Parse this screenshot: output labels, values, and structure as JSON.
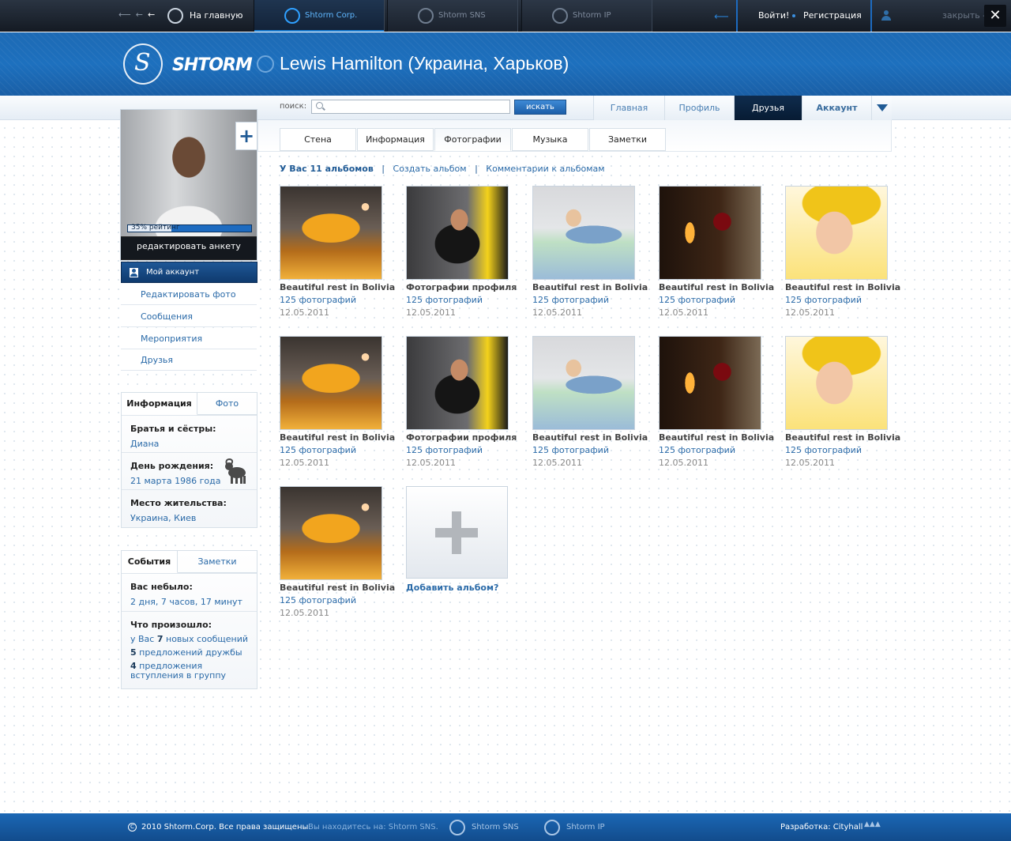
{
  "topbar": {
    "home_label": "На главную",
    "tabs": [
      "Shtorm Corp.",
      "Shtorm SNS",
      "Shtorm IP"
    ],
    "login_label": "Войти!",
    "register_label": "Регистрация",
    "close_label": "закрыть -"
  },
  "header": {
    "logo_text": "SHTORM",
    "title": "Lewis Hamilton (Украина, Харьков)"
  },
  "search": {
    "label": "поиск:",
    "placeholder": "",
    "button": "искать"
  },
  "main_nav": [
    "Главная",
    "Профиль",
    "Друзья",
    "Аккаунт"
  ],
  "profile": {
    "rating_label": "35% рейтинг",
    "rating_value": 0.35,
    "edit_label": "редактировать анкету",
    "menu_active": "Мой аккаунт",
    "menu": [
      "Редактировать фото",
      "Сообщения",
      "Мероприятия",
      "Друзья"
    ]
  },
  "info_panel": {
    "tabs": [
      "Информация",
      "Фото"
    ],
    "siblings_label": "Братья и сёстры:",
    "siblings_value": "Диана",
    "birthday_label": "День рождения:",
    "birthday_value": "21 марта 1986 года",
    "residence_label": "Место жительства:",
    "residence_value": "Украина, Киев"
  },
  "events_panel": {
    "tabs": [
      "События",
      "Заметки"
    ],
    "absent_label": "Вас небыло:",
    "absent_value": "2 дня, 7 часов, 17 минут",
    "happened_label": "Что произошло:",
    "messages_pre": "у Вас ",
    "messages_count": "7",
    "messages_post": " новых сообщений",
    "friend_count": "5",
    "friend_post": " предложений дружбы",
    "group_count": "4",
    "group_post": " предложения вступления в группу"
  },
  "content_tabs": [
    "Стена",
    "Информация",
    "Фотографии",
    "Музыка",
    "Заметки"
  ],
  "albums_header": {
    "count_label": "У Вас 11 альбомов",
    "sep": "|",
    "create": "Создать альбом",
    "comments": "Комментарии к альбомам"
  },
  "albums": [
    {
      "name": "Beautiful rest in Bolivia",
      "count": "125 фотографий",
      "date": "12.05.2011"
    },
    {
      "name": "Фотографии профиля",
      "count": "125 фотографий",
      "date": "12.05.2011"
    },
    {
      "name": "Beautiful rest in Bolivia",
      "count": "125 фотографий",
      "date": "12.05.2011"
    },
    {
      "name": "Beautiful rest in Bolivia",
      "count": "125 фотографий",
      "date": "12.05.2011"
    },
    {
      "name": "Beautiful rest in Bolivia",
      "count": "125 фотографий",
      "date": "12.05.2011"
    },
    {
      "name": "Beautiful rest in Bolivia",
      "count": "125 фотографий",
      "date": "12.05.2011"
    },
    {
      "name": "Фотографии профиля",
      "count": "125 фотографий",
      "date": "12.05.2011"
    },
    {
      "name": "Beautiful rest in Bolivia",
      "count": "125 фотографий",
      "date": "12.05.2011"
    },
    {
      "name": "Beautiful rest in Bolivia",
      "count": "125 фотографий",
      "date": "12.05.2011"
    },
    {
      "name": "Beautiful rest in Bolivia",
      "count": "125 фотографий",
      "date": "12.05.2011"
    },
    {
      "name": "Beautiful rest in Bolivia",
      "count": "125 фотографий",
      "date": "12.05.2011"
    }
  ],
  "add_album_label": "Добавить альбом?",
  "footer": {
    "copyright": "2010 Shtorm.Corp. Все права защищены.",
    "location": "Вы находитесь на: Shtorm SNS.",
    "links": [
      "Shtorm SNS",
      "Shtorm IP"
    ],
    "developer": "Разработка: Cityhall"
  },
  "colors": {
    "accent": "#1d6bc0",
    "dark_tab": "#0f2c4d",
    "link": "#2a6aa8"
  }
}
